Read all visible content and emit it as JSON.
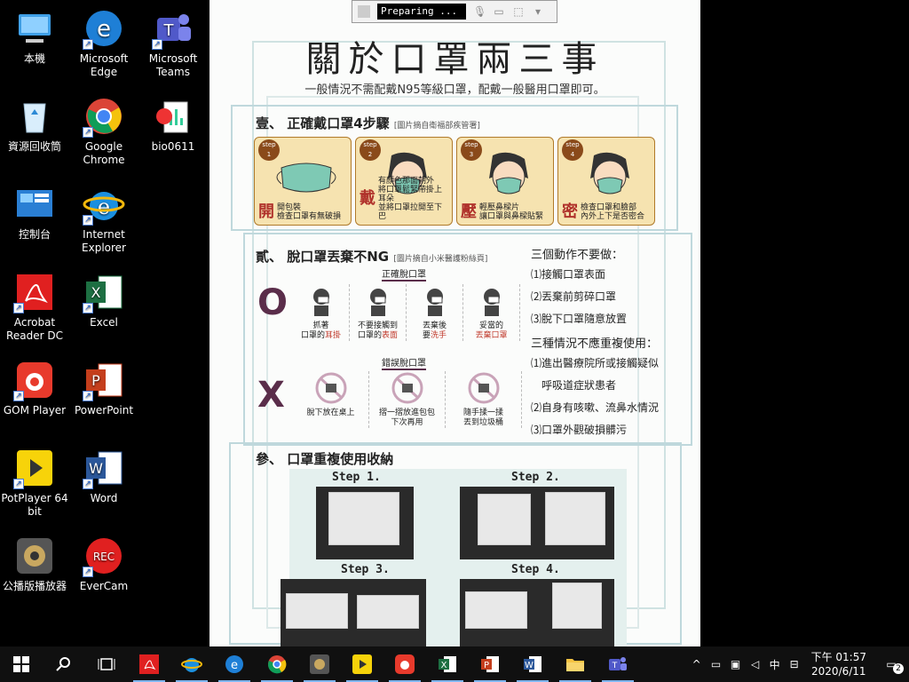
{
  "desktop": {
    "icons": [
      {
        "label": "本機",
        "shortcut": false
      },
      {
        "label": "Microsoft\nEdge",
        "shortcut": true
      },
      {
        "label": "Microsoft\nTeams",
        "shortcut": true
      },
      {
        "label": "資源回收筒",
        "shortcut": false
      },
      {
        "label": "Google\nChrome",
        "shortcut": true
      },
      {
        "label": "bio0611",
        "shortcut": false
      },
      {
        "label": "控制台",
        "shortcut": false
      },
      {
        "label": "Internet\nExplorer",
        "shortcut": true
      },
      {
        "label": "Acrobat\nReader DC",
        "shortcut": true
      },
      {
        "label": "Excel",
        "shortcut": true
      },
      {
        "label": "GOM Player",
        "shortcut": true
      },
      {
        "label": "PowerPoint",
        "shortcut": true
      },
      {
        "label": "PotPlayer 64\nbit",
        "shortcut": true
      },
      {
        "label": "Word",
        "shortcut": true
      },
      {
        "label": "公播版播放器",
        "shortcut": false
      },
      {
        "label": "EverCam",
        "shortcut": true
      }
    ]
  },
  "recorder": {
    "status": "Preparing ..."
  },
  "doc": {
    "title": "關於口罩兩三事",
    "subtitle": "一般情況不需配戴N95等級口罩，配戴一般醫用口罩即可。",
    "sec1": {
      "title": "壹、 正確戴口罩4步驟",
      "note": "[圖片摘自衛福部疾管署]",
      "steps": [
        {
          "badge": "step\n1",
          "big": "開",
          "text": "開包裝\n檢查口罩有無破損"
        },
        {
          "badge": "step\n2",
          "big": "戴",
          "text": "有顏色那面朝外\n將口罩鬆緊帶掛上耳朵\n並將口罩拉開至下巴"
        },
        {
          "badge": "step\n3",
          "big": "壓",
          "text": "輕壓鼻樑片\n讓口罩與鼻樑貼緊"
        },
        {
          "badge": "step\n4",
          "big": "密",
          "text": "檢查口罩和臉部\n內外上下是否密合"
        }
      ]
    },
    "sec2": {
      "title": "貳、 脫口罩丟棄不NG",
      "note": "[圖片摘自小米醫護粉絲頁]",
      "correct_label": "正確脫口罩",
      "wrong_label": "錯誤脫口罩",
      "correct_mark": "O",
      "wrong_mark": "X",
      "correct": [
        {
          "pre": "抓著\n口罩的",
          "hl": "耳掛"
        },
        {
          "pre": "不要接觸到\n口罩的",
          "hl": "表面"
        },
        {
          "pre": "丟棄後\n要",
          "hl": "洗手"
        },
        {
          "pre": "妥當的\n",
          "hl": "丟棄口罩"
        }
      ],
      "wrong": [
        {
          "text": "脫下放在桌上"
        },
        {
          "text": "摺一摺放進包包\n下次再用"
        },
        {
          "text": "隨手揉一揉\n丟到垃圾桶"
        }
      ],
      "dont_head": "三個動作不要做：",
      "dont": [
        "⑴接觸口罩表面",
        "⑵丟棄前剪碎口罩",
        "⑶脫下口罩隨意放置"
      ],
      "no_reuse_head": "三種情況不應重複使用：",
      "no_reuse": [
        "⑴進出醫療院所或接觸疑似",
        "　呼吸道症狀患者",
        "⑵自身有咳嗽、流鼻水情況",
        "⑶口罩外觀破損髒污"
      ]
    },
    "sec3": {
      "title": "參、 口罩重複使用收納",
      "steps": [
        "Step 1.",
        "Step 2.",
        "Step 3.",
        "Step 4."
      ]
    }
  },
  "taskbar": {
    "apps": [
      "start-icon",
      "search-icon",
      "task-view-icon",
      "acrobat-icon",
      "ie-icon",
      "edge-icon",
      "chrome-icon",
      "gom-icon",
      "potplayer-icon",
      "gom-player-icon",
      "excel-icon",
      "powerpoint-icon",
      "word-icon",
      "file-explorer-icon",
      "teams-icon"
    ],
    "ime": "中",
    "time": "下午 01:57",
    "date": "2020/6/11",
    "notifications": "2"
  }
}
